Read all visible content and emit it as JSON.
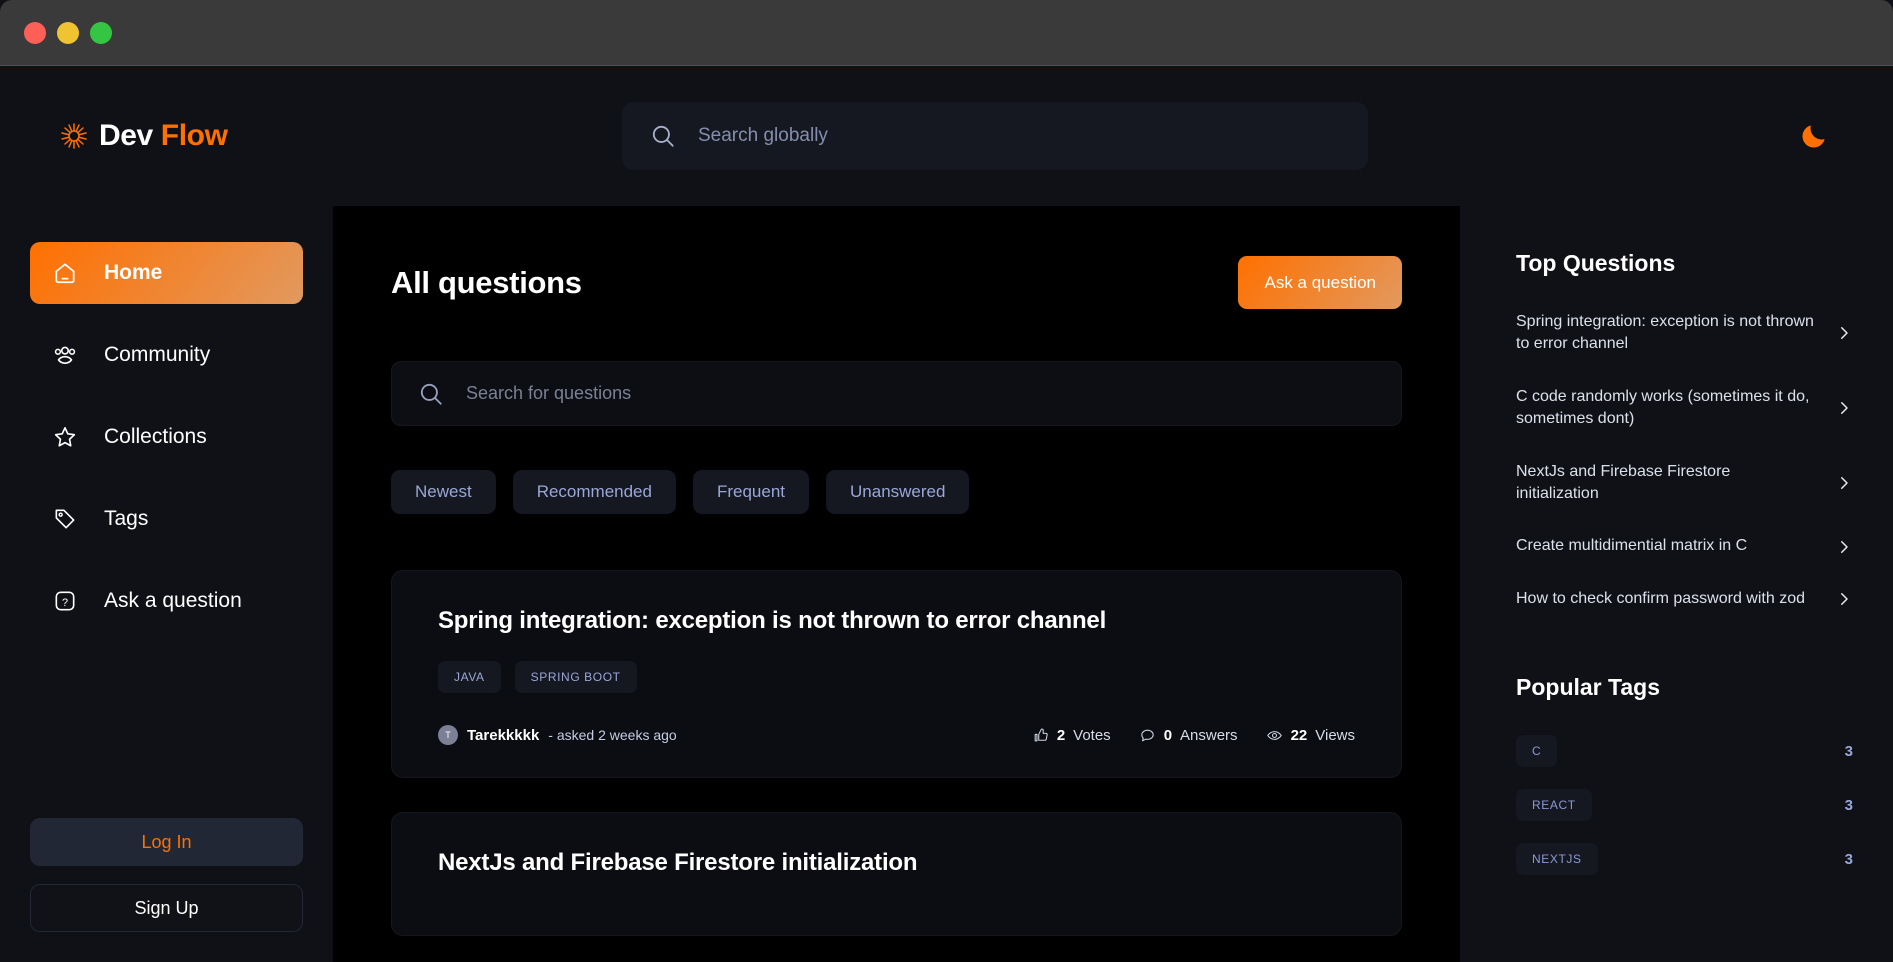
{
  "window": {
    "traffic_lights": [
      "close",
      "minimize",
      "maximize"
    ]
  },
  "navbar": {
    "logo_text_primary": "Dev",
    "logo_text_accent": "Flow",
    "logo_icon": "sun-starburst-icon",
    "search": {
      "icon": "search-icon",
      "placeholder": "Search globally",
      "value": ""
    },
    "theme_toggle_icon": "moon-icon"
  },
  "sidebar": {
    "items": [
      {
        "label": "Home",
        "icon": "home-icon",
        "active": true
      },
      {
        "label": "Community",
        "icon": "users-icon",
        "active": false
      },
      {
        "label": "Collections",
        "icon": "star-icon",
        "active": false
      },
      {
        "label": "Tags",
        "icon": "tag-icon",
        "active": false
      },
      {
        "label": "Ask a question",
        "icon": "question-mark-icon",
        "active": false
      }
    ],
    "login_label": "Log In",
    "signup_label": "Sign Up"
  },
  "main": {
    "page_title": "All questions",
    "ask_button_label": "Ask a question",
    "search": {
      "icon": "search-icon",
      "placeholder": "Search for questions",
      "value": ""
    },
    "filters": [
      "Newest",
      "Recommended",
      "Frequent",
      "Unanswered"
    ],
    "questions": [
      {
        "title": "Spring integration: exception is not thrown to error channel",
        "tags": [
          "JAVA",
          "SPRING BOOT"
        ],
        "author": "Tarekkkkk",
        "author_initial": "T",
        "asked": "- asked 2 weeks ago",
        "metrics": [
          {
            "icon": "thumbs-up-icon",
            "value": "2",
            "label": "Votes"
          },
          {
            "icon": "message-icon",
            "value": "0",
            "label": "Answers"
          },
          {
            "icon": "eye-icon",
            "value": "22",
            "label": "Views"
          }
        ]
      },
      {
        "title": "NextJs and Firebase Firestore initialization",
        "tags": [],
        "author": "",
        "author_initial": "",
        "asked": "",
        "metrics": []
      }
    ]
  },
  "rightbar": {
    "top_questions_title": "Top Questions",
    "top_questions": [
      "Spring integration: exception is not thrown to error channel",
      "C code randomly works (sometimes it do, sometimes dont)",
      "NextJs and Firebase Firestore initialization",
      "Create multidimential matrix in C",
      "How to check confirm password with zod"
    ],
    "popular_tags_title": "Popular Tags",
    "popular_tags": [
      {
        "name": "C",
        "count": "3"
      },
      {
        "name": "REACT",
        "count": "3"
      },
      {
        "name": "NEXTJS",
        "count": "3"
      }
    ]
  },
  "colors": {
    "accent_orange": "#ff7000",
    "accent_gradient_end": "#e2995f",
    "dark_bg": "#0f1117",
    "main_bg": "#000000",
    "card_bg": "#0b0d12",
    "pill_bg": "#151821",
    "pill_text": "#9aa7d7"
  }
}
